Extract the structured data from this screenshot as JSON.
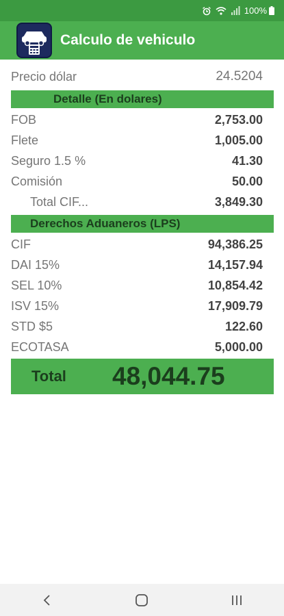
{
  "status": {
    "battery": "100%"
  },
  "app_bar": {
    "title": "Calculo de vehiculo"
  },
  "dollar": {
    "label": "Precio dólar",
    "value": "24.5204"
  },
  "section1": {
    "title": "Detalle (En dolares)"
  },
  "detail_rows": [
    {
      "label": "FOB",
      "value": "2,753.00"
    },
    {
      "label": "Flete",
      "value": "1,005.00"
    },
    {
      "label": "Seguro 1.5 %",
      "value": "41.30"
    },
    {
      "label": "Comisión",
      "value": "50.00"
    },
    {
      "label": "Total CIF...",
      "value": "3,849.30"
    }
  ],
  "section2": {
    "title": "Derechos Aduaneros (LPS)"
  },
  "duty_rows": [
    {
      "label": "CIF",
      "value": "94,386.25"
    },
    {
      "label": "DAI 15%",
      "value": "14,157.94"
    },
    {
      "label": "SEL 10%",
      "value": "10,854.42"
    },
    {
      "label": "ISV 15%",
      "value": "17,909.79"
    },
    {
      "label": "STD $5",
      "value": "122.60"
    },
    {
      "label": "ECOTASA",
      "value": "5,000.00"
    }
  ],
  "total": {
    "label": "Total",
    "value": "48,044.75"
  },
  "icons": {
    "alarm": "alarm-icon",
    "wifi": "wifi-icon",
    "signal": "signal-icon",
    "battery": "battery-icon",
    "app": "car-calculator-icon",
    "back": "back-icon",
    "home": "home-icon",
    "recents": "recents-icon"
  },
  "colors": {
    "primary": "#4caf50",
    "status_bar": "#3c9a41",
    "accent_text": "#1b3e1d"
  }
}
